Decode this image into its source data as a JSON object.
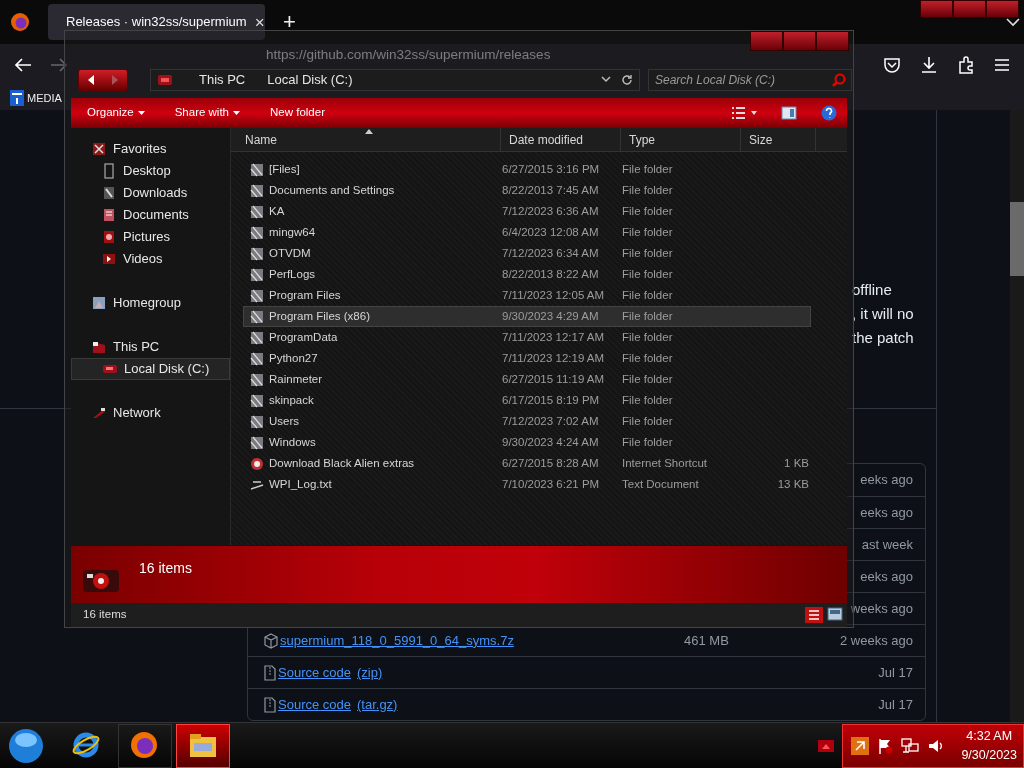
{
  "browser": {
    "tab": {
      "title": "Releases · win32ss/supermium",
      "close": "×",
      "selected": true
    },
    "new_tab": "+",
    "url": "https://github.com/win32ss/supermium/releases",
    "bookmark": "MEDIA"
  },
  "page": {
    "text_lines": [
      "offline",
      ", it will no",
      "the patch"
    ],
    "assets": [
      {
        "age": "eeks ago"
      },
      {
        "age": "eeks ago"
      },
      {
        "age": "ast week"
      },
      {
        "age": "eeks ago"
      },
      {
        "age": "weeks ago"
      },
      {
        "kind": "package",
        "name": "supermium_118_0_5991_0_64_syms.7z",
        "size": "461 MB",
        "age": "2 weeks ago"
      },
      {
        "kind": "source",
        "name": "Source code",
        "suffix": "(zip)",
        "age": "Jul 17"
      },
      {
        "kind": "source",
        "name": "Source code",
        "suffix": "(tar.gz)",
        "age": "Jul 17"
      }
    ]
  },
  "explorer": {
    "breadcrumb": [
      "This PC",
      "Local Disk (C:)"
    ],
    "search_placeholder": "Search Local Disk (C:)",
    "toolbar": [
      {
        "label": "Organize",
        "menu": true
      },
      {
        "label": "Share with",
        "menu": true
      },
      {
        "label": "New folder",
        "menu": false
      }
    ],
    "nav": [
      {
        "label": "Favorites",
        "kind": "star",
        "selected": false,
        "children": [
          {
            "label": "Desktop",
            "kind": "desktop",
            "selected": false
          },
          {
            "label": "Downloads",
            "kind": "downloads",
            "selected": false
          },
          {
            "label": "Documents",
            "kind": "documents",
            "selected": false
          },
          {
            "label": "Pictures",
            "kind": "pictures",
            "selected": false
          },
          {
            "label": "Videos",
            "kind": "videos",
            "selected": false
          }
        ]
      },
      {
        "label": "Homegroup",
        "kind": "homegroup",
        "selected": false
      },
      {
        "label": "This PC",
        "kind": "pc",
        "selected": false,
        "children": [
          {
            "label": "Local Disk (C:)",
            "kind": "disk",
            "selected": true
          }
        ]
      },
      {
        "label": "Network",
        "kind": "network",
        "selected": false
      }
    ],
    "columns": [
      {
        "label": "Name",
        "sorted": true
      },
      {
        "label": "Date modified",
        "sorted": false
      },
      {
        "label": "Type",
        "sorted": false
      },
      {
        "label": "Size",
        "sorted": false
      }
    ],
    "files": [
      {
        "kind": "folder",
        "name": "[Files]",
        "date": "6/27/2015 3:16 PM",
        "type": "File folder",
        "selected": false
      },
      {
        "kind": "folder",
        "name": "Documents and Settings",
        "date": "8/22/2013 7:45 AM",
        "type": "File folder",
        "selected": false
      },
      {
        "kind": "folder",
        "name": "KA",
        "date": "7/12/2023 6:36 AM",
        "type": "File folder",
        "selected": false
      },
      {
        "kind": "folder",
        "name": "mingw64",
        "date": "6/4/2023 12:08 AM",
        "type": "File folder",
        "selected": false
      },
      {
        "kind": "folder",
        "name": "OTVDM",
        "date": "7/12/2023 6:34 AM",
        "type": "File folder",
        "selected": false
      },
      {
        "kind": "folder",
        "name": "PerfLogs",
        "date": "8/22/2013 8:22 AM",
        "type": "File folder",
        "selected": false
      },
      {
        "kind": "folder",
        "name": "Program Files",
        "date": "7/11/2023 12:05 AM",
        "type": "File folder",
        "selected": false
      },
      {
        "kind": "folder",
        "name": "Program Files (x86)",
        "date": "9/30/2023 4:29 AM",
        "type": "File folder",
        "selected": true
      },
      {
        "kind": "folder",
        "name": "ProgramData",
        "date": "7/11/2023 12:17 AM",
        "type": "File folder",
        "selected": false
      },
      {
        "kind": "folder",
        "name": "Python27",
        "date": "7/11/2023 12:19 AM",
        "type": "File folder",
        "selected": false
      },
      {
        "kind": "folder",
        "name": "Rainmeter",
        "date": "6/27/2015 11:19 AM",
        "type": "File folder",
        "selected": false
      },
      {
        "kind": "folder",
        "name": "skinpack",
        "date": "6/17/2015 8:19 PM",
        "type": "File folder",
        "selected": false
      },
      {
        "kind": "folder",
        "name": "Users",
        "date": "7/12/2023 7:02 AM",
        "type": "File folder",
        "selected": false
      },
      {
        "kind": "folder",
        "name": "Windows",
        "date": "9/30/2023 4:24 AM",
        "type": "File folder",
        "selected": false
      },
      {
        "kind": "shortcut",
        "name": "Download Black Alien extras",
        "date": "6/27/2015 8:28 AM",
        "type": "Internet Shortcut",
        "size": "1 KB",
        "selected": false
      },
      {
        "kind": "text",
        "name": "WPI_Log.txt",
        "date": "7/10/2023 6:21 PM",
        "type": "Text Document",
        "size": "13 KB",
        "selected": false
      }
    ],
    "details": "16 items",
    "status": "16 items"
  },
  "taskbar": {
    "apps": [
      {
        "kind": "ie",
        "active": false
      },
      {
        "kind": "firefox",
        "active": false
      },
      {
        "kind": "explorer",
        "active": true
      }
    ],
    "time": "4:32 AM",
    "date": "9/30/2023"
  }
}
